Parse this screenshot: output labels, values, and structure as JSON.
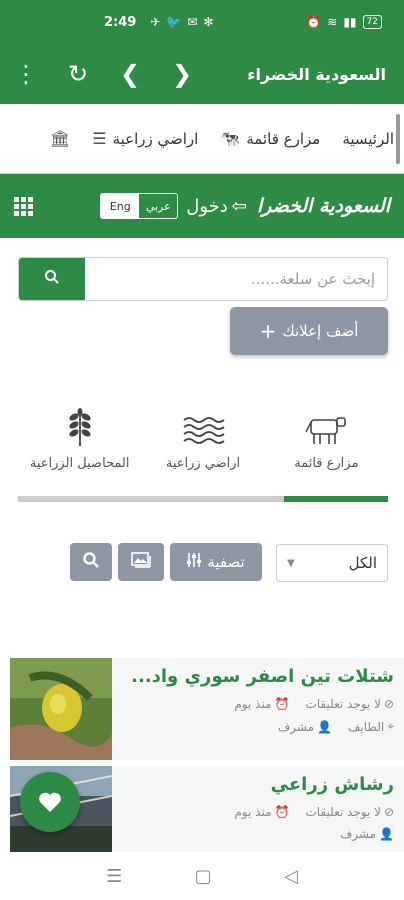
{
  "status_bar": {
    "time": "2:49",
    "battery": "72"
  },
  "app_bar": {
    "title": "السعودية الخضراء",
    "icons": [
      "more-vert-icon",
      "refresh-icon",
      "back-icon",
      "forward-icon"
    ]
  },
  "nav_menu": {
    "items": [
      {
        "label": "الرئيسية",
        "icon": "home-icon"
      },
      {
        "label": "مزارع قائمة",
        "icon": "farm-icon"
      },
      {
        "label": "اراضي زراعية",
        "icon": "land-icon"
      }
    ]
  },
  "site_header": {
    "brand": "السعودية الخضرا",
    "login": "دخول",
    "lang_ar": "عربي",
    "lang_en": "Eng"
  },
  "search": {
    "placeholder": "إبحث عن سلعة......"
  },
  "add_ad": {
    "label": "أضف إعلانك"
  },
  "categories": {
    "items": [
      {
        "label": "مزارع قائمة",
        "icon": "cow-icon"
      },
      {
        "label": "اراضي زراعية",
        "icon": "land-icon"
      },
      {
        "label": "المحاصيل الزراعية",
        "icon": "wheat-icon"
      }
    ],
    "scroll_progress": 0.28
  },
  "filters": {
    "select_value": "الكل",
    "filter_label": "تصفية"
  },
  "listings": [
    {
      "title": "شتلات تين اصفر سوري واد...",
      "comments": "لا يوجد تعليقات",
      "time": "منذ يوم",
      "location": "الطايف",
      "role": "مشرف"
    },
    {
      "title": "رشاش زراعي",
      "comments": "لا يوجد تعليقات",
      "time": "منذ يوم",
      "location": "",
      "role": "مشرف"
    }
  ],
  "colors": {
    "primary": "#2e8b46",
    "secondary_button": "#8e96a3",
    "listing_bg": "#f5f7f7"
  }
}
